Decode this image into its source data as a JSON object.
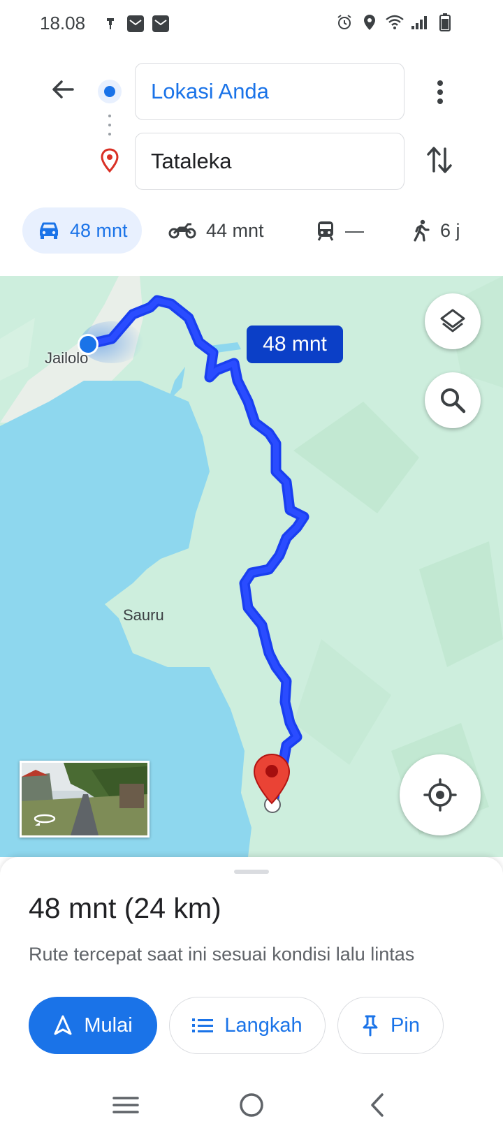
{
  "status_bar": {
    "time": "18.08",
    "left_icons": [
      "notification-pin-icon",
      "mail-icon",
      "mail-icon"
    ],
    "right_icons": [
      "alarm-icon",
      "location-icon",
      "wifi-icon",
      "signal-icon",
      "battery-icon"
    ]
  },
  "directions": {
    "origin": "Lokasi Anda",
    "destination": "Tataleka"
  },
  "modes": [
    {
      "id": "drive",
      "icon": "car-icon",
      "label": "48 mnt",
      "active": true
    },
    {
      "id": "motorcycle",
      "icon": "motorcycle-icon",
      "label": "44 mnt",
      "active": false
    },
    {
      "id": "transit",
      "icon": "train-icon",
      "label": "—",
      "active": false
    },
    {
      "id": "walk",
      "icon": "walk-icon",
      "label": "6 j",
      "active": false
    }
  ],
  "map": {
    "labels": {
      "jailolo": "Jailolo",
      "sauru": "Sauru"
    },
    "route_time_badge": "48 mnt",
    "route_color": "#1a3ff0",
    "water_color": "#8ed7ee",
    "land_color": "#cdeedd"
  },
  "sheet": {
    "duration": "48 mnt",
    "distance": "(24 km)",
    "description": "Rute tercepat saat ini sesuai kondisi lalu lintas",
    "buttons": {
      "start": "Mulai",
      "steps": "Langkah",
      "pin": "Pin"
    }
  },
  "colors": {
    "accent": "#1a73e8",
    "destination_pin": "#d93025"
  }
}
